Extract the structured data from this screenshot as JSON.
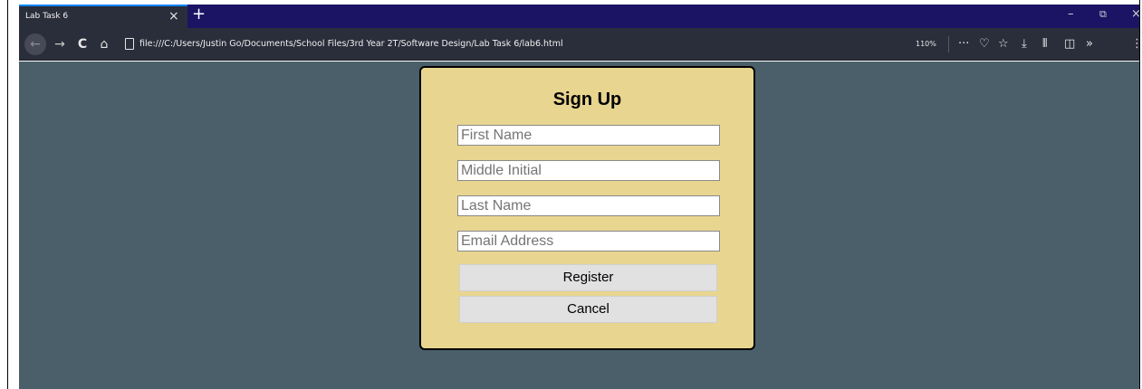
{
  "browser": {
    "tab_title": "Lab Task 6",
    "tab_close_glyph": "×",
    "new_tab_glyph": "+",
    "url": "file:///C:/Users/Justin Go/Documents/School Files/3rd Year 2T/Software Design/Lab Task 6/lab6.html",
    "zoom": "110%",
    "window_minimize_glyph": "–",
    "window_restore_glyph": "⧉",
    "window_close_glyph": "×",
    "icons": {
      "back": "back-arrow-icon",
      "forward": "forward-arrow-icon",
      "reload": "reload-icon",
      "home": "home-icon",
      "page": "page-icon",
      "more": "more-icon",
      "pocket": "pocket-icon",
      "bookmark": "star-icon",
      "downloads": "download-icon",
      "library": "library-icon",
      "sidebar": "sidebar-icon",
      "overflow": "chevron-double-right-icon"
    }
  },
  "form": {
    "title": "Sign Up",
    "fields": [
      {
        "placeholder": "First Name",
        "value": ""
      },
      {
        "placeholder": "Middle Initial",
        "value": ""
      },
      {
        "placeholder": "Last Name",
        "value": ""
      },
      {
        "placeholder": "Email Address",
        "value": ""
      }
    ],
    "register_label": "Register",
    "cancel_label": "Cancel"
  },
  "colors": {
    "page_background": "#4a5f69",
    "card_background": "#e8d590",
    "tabbar": "#1b1464",
    "toolbar": "#2a2d3a",
    "button": "#e1e1e1"
  }
}
